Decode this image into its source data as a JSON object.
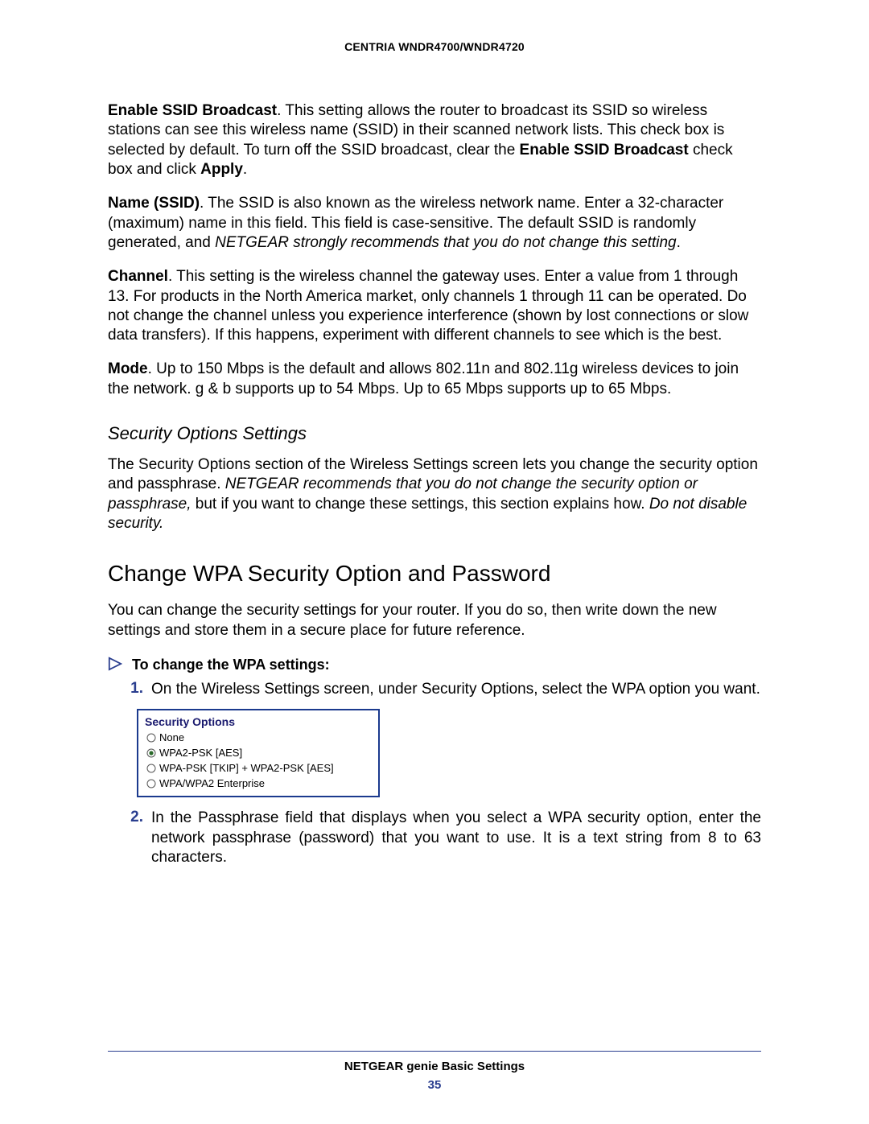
{
  "doc": {
    "header": "CENTRIA WNDR4700/WNDR4720",
    "footer_title": "NETGEAR genie Basic Settings",
    "page_number": "35"
  },
  "p1": {
    "bold_lead": "Enable SSID Broadcast",
    "run1": ". This setting allows the router to broadcast its SSID so wireless stations can see this wireless name (SSID) in their scanned network lists. This check box is selected by default. To turn off the SSID broadcast, clear the ",
    "bold2": "Enable SSID Broadcast",
    "run2": " check box and click ",
    "bold3": "Apply",
    "run3": "."
  },
  "p2": {
    "bold_lead": "Name (SSID)",
    "run1": ". The SSID is also known as the wireless network name. Enter a 32-character (maximum) name in this field. This field is case-sensitive. The default SSID is randomly generated, and ",
    "italic1": "NETGEAR strongly recommends that you do not change this setting",
    "run2": "."
  },
  "p3": {
    "bold_lead": "Channel",
    "run1": ". This setting is the wireless channel the gateway uses. Enter a value from 1 through 13. For products in the North America market, only channels 1 through 11 can be operated. Do not change the channel unless you experience interference (shown by lost connections or slow data transfers). If this happens, experiment with different channels to see which is the best."
  },
  "p4": {
    "bold_lead": "Mode",
    "run1": ". Up to 150 Mbps is the default and allows 802.11n and 802.11g wireless devices to join the network. g & b supports up to 54 Mbps. Up to 65 Mbps supports up to 65 Mbps."
  },
  "h3": "Security Options Settings",
  "p5": {
    "run1": "The Security Options section of the Wireless Settings screen lets you change the security option and passphrase. ",
    "italic1": "NETGEAR recommends that you do not change the security option or passphrase,",
    "run2": " but if you want to change these settings, this section explains how. ",
    "italic2": "Do not disable security."
  },
  "h2": "Change WPA Security Option and Password",
  "p6": "You can change the security settings for your router. If you do so, then write down the new settings and store them in a secure place for future reference.",
  "proc_label": "To change the WPA settings:",
  "steps": {
    "s1_num": "1.",
    "s1": "On the Wireless Settings screen, under Security Options, select the WPA option you want.",
    "s2_num": "2.",
    "s2": "In the Passphrase field that displays when you select a WPA security option, enter the network passphrase (password) that you want to use. It is a text string from 8 to 63 characters."
  },
  "sec_options": {
    "title": "Security Options",
    "opts": {
      "o0": "None",
      "o1": "WPA2-PSK [AES]",
      "o2": "WPA-PSK [TKIP] + WPA2-PSK [AES]",
      "o3": "WPA/WPA2 Enterprise"
    },
    "selected_index": 1
  }
}
